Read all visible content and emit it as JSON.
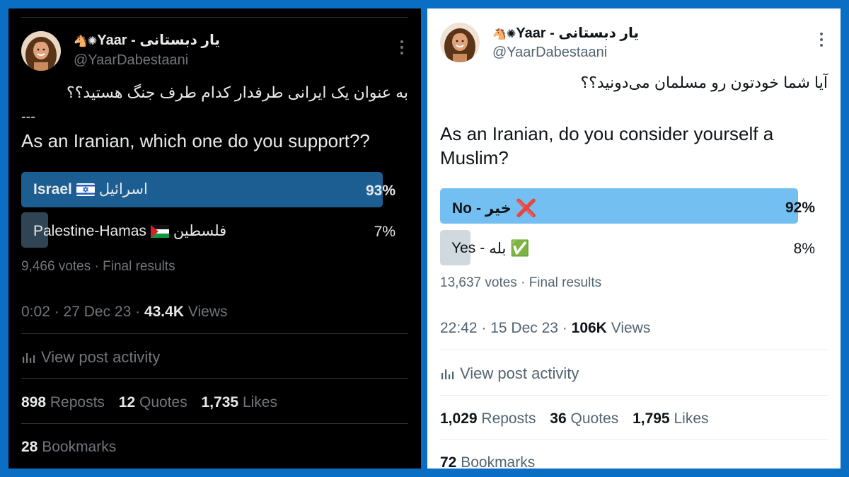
{
  "left_tweet": {
    "author": {
      "name": "Yaar - یار دبستانی",
      "name_prefix_emoji": "🐴✺",
      "handle": "@YaarDabestaani"
    },
    "text_fa": "به عنوان یک ایرانی طرفدار کدام طرف جنگ هستید؟؟",
    "separator": "---",
    "text_en": "As an Iranian, which one do you support??",
    "poll": {
      "options": [
        {
          "label_en": "Israel",
          "label_fa": "اسرائیل",
          "flag": "israel-flag",
          "percent": 93,
          "percent_label": "93%",
          "winner": true
        },
        {
          "label_en": "Palestine-Hamas",
          "label_fa": "فلسطین",
          "flag": "palestine-flag",
          "percent": 7,
          "percent_label": "7%",
          "winner": false
        }
      ],
      "votes": "9,466 votes",
      "status": "Final results"
    },
    "time": "0:02",
    "date": "27 Dec 23",
    "views_count": "43.4K",
    "views_label": "Views",
    "activity_label": "View post activity",
    "reposts_count": "898",
    "reposts_label": "Reposts",
    "quotes_count": "12",
    "quotes_label": "Quotes",
    "likes_count": "1,735",
    "likes_label": "Likes",
    "bookmarks_count": "28",
    "bookmarks_label": "Bookmarks",
    "colors": {
      "winner_bar": "#1d5e92",
      "loser_bar": "#2f4454",
      "muted": "#71767b",
      "divider": "#2f3336"
    }
  },
  "right_tweet": {
    "author": {
      "name": "Yaar - یار دبستانی",
      "name_prefix_emoji": "🐴✺",
      "handle": "@YaarDabestaani"
    },
    "text_fa": "آیا شما خودتون رو مسلمان می‌دونید؟؟",
    "text_en": "As an Iranian, do you consider yourself a Muslim?",
    "poll": {
      "options": [
        {
          "label_en": "No",
          "label_fa": "خیر",
          "mark": "❌",
          "percent": 92,
          "percent_label": "92%",
          "winner": true
        },
        {
          "label_en": "Yes",
          "label_fa": "بله",
          "mark": "✅",
          "percent": 8,
          "percent_label": "8%",
          "winner": false
        }
      ],
      "votes": "13,637 votes",
      "status": "Final results"
    },
    "time": "22:42",
    "date": "15 Dec 23",
    "views_count": "106K",
    "views_label": "Views",
    "activity_label": "View post activity",
    "reposts_count": "1,029",
    "reposts_label": "Reposts",
    "quotes_count": "36",
    "quotes_label": "Quotes",
    "likes_count": "1,795",
    "likes_label": "Likes",
    "bookmarks_count": "72",
    "bookmarks_label": "Bookmarks",
    "colors": {
      "winner_bar": "#74bff2",
      "loser_bar": "#cfd9de",
      "muted": "#536471",
      "divider": "#eff3f4"
    }
  },
  "frame_color": "#0a6fc4"
}
